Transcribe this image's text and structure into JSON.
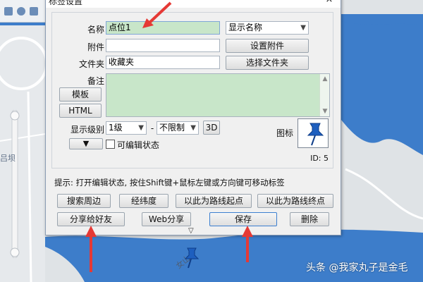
{
  "dialog": {
    "title": "标签设置",
    "close_glyph": "×"
  },
  "form": {
    "name_label": "名称",
    "name_value": "点位1",
    "display_select": "显示名称",
    "attachment_label": "附件",
    "attachment_value": "",
    "set_attachment_button": "设置附件",
    "folder_label": "文件夹",
    "folder_value": "收藏夹",
    "select_folder_button": "选择文件夹",
    "note_label": "备注",
    "template_button": "模板",
    "html_button": "HTML",
    "level_label": "显示级别",
    "level_from": "1级",
    "level_sep": "-",
    "level_to": "不限制",
    "three_d_button": "3D",
    "icon_label": "图标",
    "icon_id": "ID: 5",
    "editable_label": "可编辑状态",
    "editable_checked": false
  },
  "hint": "提示: 打开编辑状态, 按住Shift键+鼠标左键或方向键可移动标签",
  "actions": {
    "search_nearby": "搜索周边",
    "lat_lng": "经纬度",
    "route_start": "以此为路线起点",
    "route_end": "以此为路线终点",
    "share_friends": "分享给好友",
    "web_share": "Web分享",
    "save": "保存",
    "delete": "删除"
  },
  "map": {
    "side_label": "吕坝",
    "bottom_label": "女山"
  },
  "watermark": "头条 @我家丸子是金毛",
  "colors": {
    "accent_red": "#e53935",
    "field_green": "#c8e6c9",
    "water_blue": "#3d7dca",
    "pin_blue": "#1e5fbf"
  }
}
